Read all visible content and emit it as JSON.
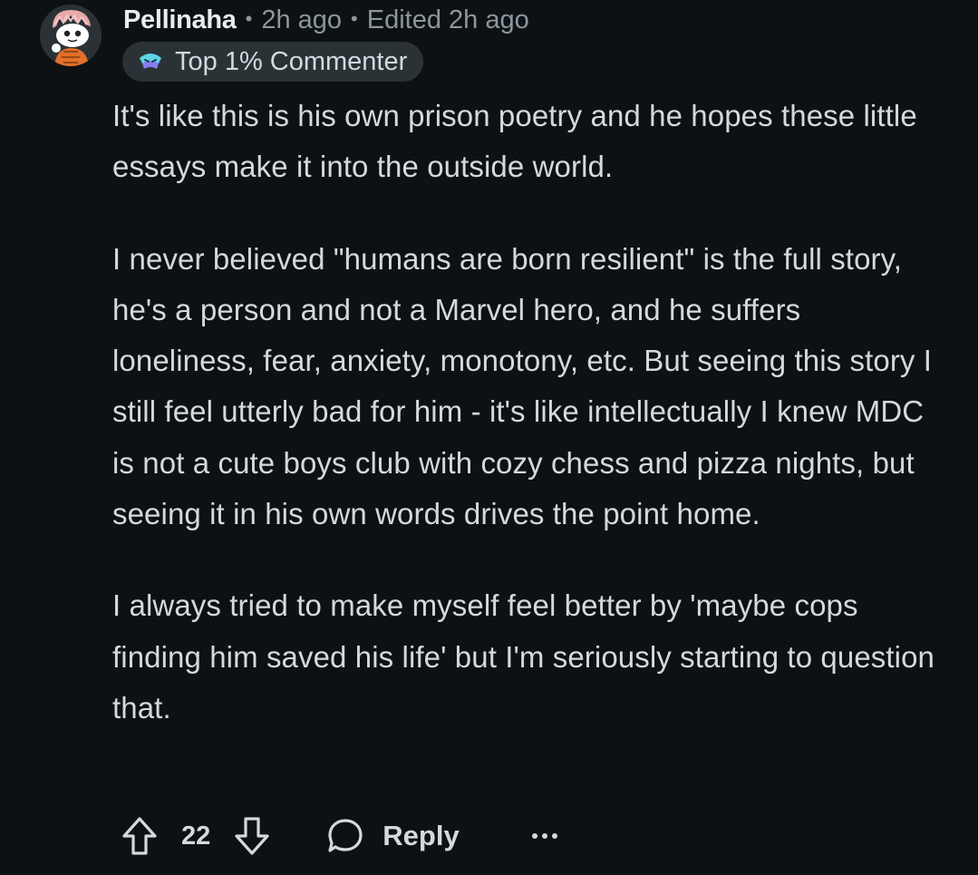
{
  "comment": {
    "username": "Pellinaha",
    "time": "2h ago",
    "edited": "Edited 2h ago",
    "flair": {
      "label": "Top 1% Commenter",
      "icon": "commenter-badge-icon"
    },
    "avatar_icon": "snoo-avatar-icon",
    "paragraphs": [
      "It's like this is his own prison poetry and he hopes these little essays make it into the outside world.",
      "I never believed \"humans are born resilient\" is the full story, he's a person and not a Marvel hero, and he suffers loneliness, fear, anxiety, monotony, etc. But seeing this story I still feel utterly bad for him - it's like intellectually I knew MDC is not a cute boys club with cozy chess and pizza nights, but seeing it in his own words drives the point home.",
      "I always tried to make myself feel better by 'maybe cops finding him saved his life' but I'm seriously starting to question that."
    ],
    "actions": {
      "score": "22",
      "reply_label": "Reply",
      "upvote_icon": "upvote-icon",
      "downvote_icon": "downvote-icon",
      "reply_icon": "speech-bubble-icon",
      "more_icon": "more-options-icon"
    }
  },
  "colors": {
    "background": "#0e1113",
    "text": "#d2dadf",
    "muted": "#8a979e",
    "pill": "#2a3236"
  }
}
